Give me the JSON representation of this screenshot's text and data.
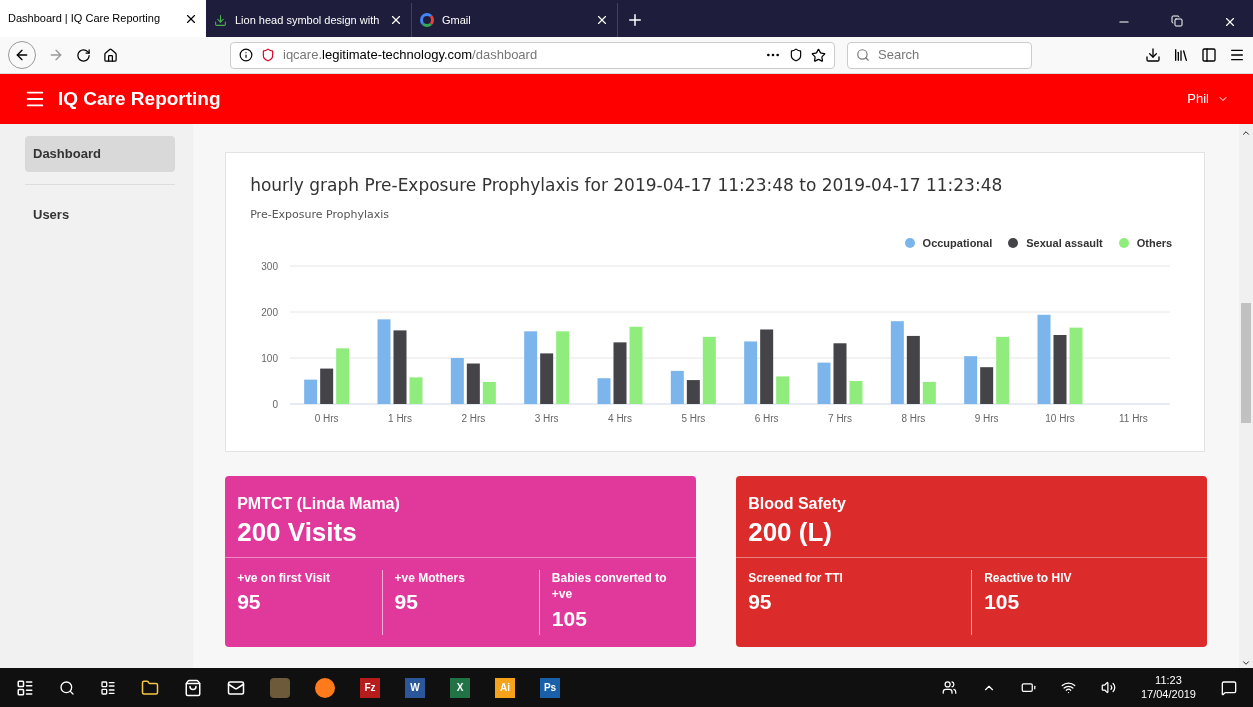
{
  "browser": {
    "tabs": [
      {
        "title": "Dashboard | IQ Care Reporting",
        "kind": "plain",
        "selected": true
      },
      {
        "title": "Lion head symbol design with",
        "kind": "download",
        "selected": false
      },
      {
        "title": "Gmail",
        "kind": "google",
        "selected": false
      }
    ],
    "url_host": "iqcare.",
    "url_domain": "legitimate-technology.com",
    "url_path": "/dashboard",
    "search_placeholder": "Search"
  },
  "app": {
    "title": "IQ Care Reporting",
    "user": "Phil"
  },
  "sidebar": {
    "items": [
      {
        "label": "Dashboard",
        "selected": true
      },
      {
        "label": "Users",
        "selected": false
      }
    ]
  },
  "chart_card": {
    "title": "hourly graph Pre-Exposure Prophylaxis for 2019-04-17 11:23:48 to 2019-04-17 11:23:48",
    "chart_data": {
      "type": "bar",
      "title": "Pre-Exposure Prophylaxis",
      "categories": [
        "0 Hrs",
        "1 Hrs",
        "2 Hrs",
        "3 Hrs",
        "4 Hrs",
        "5 Hrs",
        "6 Hrs",
        "7 Hrs",
        "8 Hrs",
        "9 Hrs",
        "10 Hrs",
        "11 Hrs"
      ],
      "ylim": [
        0,
        300
      ],
      "yticks": [
        0,
        100,
        200,
        300
      ],
      "series": [
        {
          "name": "Occupational",
          "color": "#7cb5ec",
          "values": [
            53,
            184,
            100,
            158,
            56,
            72,
            136,
            90,
            180,
            104,
            194,
            null
          ]
        },
        {
          "name": "Sexual assault",
          "color": "#434348",
          "values": [
            77,
            160,
            88,
            110,
            134,
            52,
            162,
            132,
            148,
            80,
            150,
            null
          ]
        },
        {
          "name": "Others",
          "color": "#90ed7d",
          "values": [
            121,
            58,
            48,
            158,
            168,
            146,
            60,
            50,
            48,
            146,
            166,
            null
          ]
        }
      ]
    }
  },
  "stat_cards": [
    {
      "title": "PMTCT (Linda Mama)",
      "value": "200 Visits",
      "color": "#e0399b",
      "stats": [
        {
          "label": "+ve on first Visit",
          "value": "95"
        },
        {
          "label": "+ve Mothers",
          "value": "95"
        },
        {
          "label": "Babies converted to +ve",
          "value": "105"
        }
      ]
    },
    {
      "title": "Blood Safety",
      "value": "200 (L)",
      "color": "#dc2b2b",
      "stats": [
        {
          "label": "Screened for TTI",
          "value": "95"
        },
        {
          "label": "Reactive to HIV",
          "value": "105"
        }
      ]
    }
  ],
  "taskbar": {
    "apps": [
      {
        "label": "Fz",
        "color": "#b71c1c"
      },
      {
        "label": "W",
        "color": "#2b579a"
      },
      {
        "label": "X",
        "color": "#217346"
      },
      {
        "label": "Ai",
        "color": "#f7a21b"
      },
      {
        "label": "Ps",
        "color": "#1a5fa8"
      }
    ],
    "time": "11:23",
    "date": "17/04/2019"
  }
}
